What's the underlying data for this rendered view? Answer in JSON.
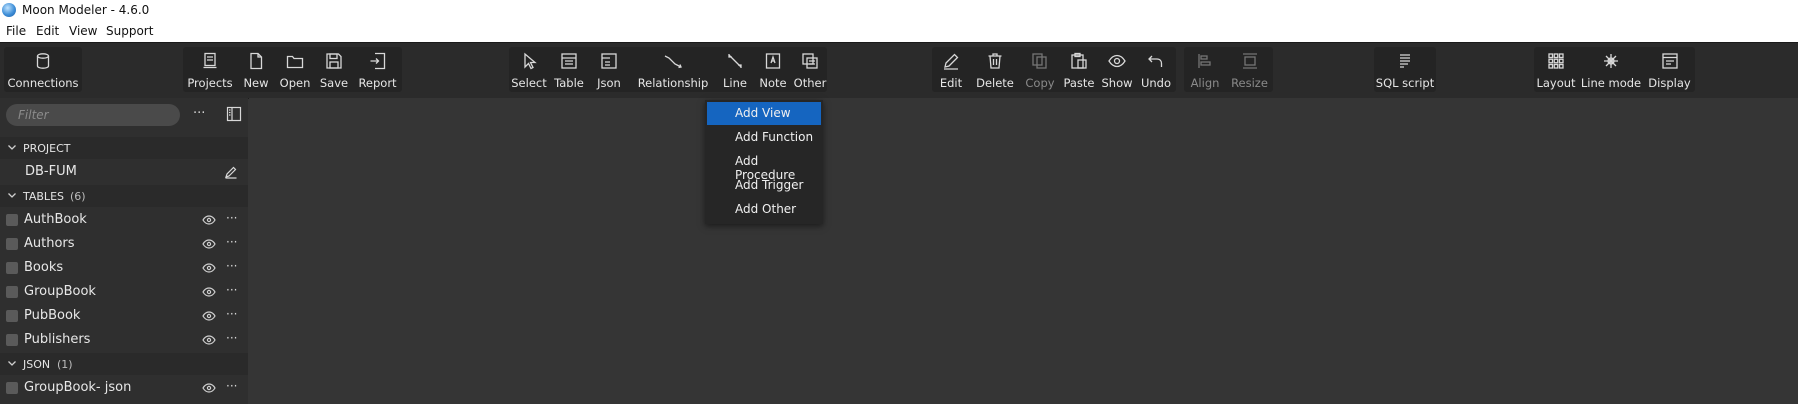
{
  "window": {
    "title": "Moon Modeler - 4.6.0"
  },
  "menu": [
    "File",
    "Edit",
    "View",
    "Support"
  ],
  "toolbar": {
    "connections": "Connections",
    "projects": "Projects",
    "new": "New",
    "open": "Open",
    "save": "Save",
    "report": "Report",
    "select": "Select",
    "table": "Table",
    "json": "Json",
    "relationship": "Relationship",
    "line": "Line",
    "note": "Note",
    "other": "Other",
    "edit": "Edit",
    "delete": "Delete",
    "copy": "Copy",
    "paste": "Paste",
    "show": "Show",
    "undo": "Undo",
    "align": "Align",
    "resize": "Resize",
    "sql_script": "SQL script",
    "layout": "Layout",
    "line_mode": "Line mode",
    "display": "Display"
  },
  "sidebar": {
    "filter_placeholder": "Filter",
    "project_header": "PROJECT",
    "project_name": "DB-FUM",
    "tables_header": "TABLES",
    "tables_count": "(6)",
    "tables": [
      "AuthBook",
      "Authors",
      "Books",
      "GroupBook",
      "PubBook",
      "Publishers"
    ],
    "json_header": "JSON",
    "json_count": "(1)",
    "json_items": [
      "GroupBook- json"
    ]
  },
  "other_menu": {
    "items": [
      "Add View",
      "Add Function",
      "Add Procedure",
      "Add Trigger",
      "Add Other"
    ],
    "selected": "Add View"
  },
  "colors": {
    "accent": "#1565c0",
    "toolbar_bg": "#2b2b2b",
    "canvas_bg": "#353535",
    "sidebar_bg": "#2f2f2f"
  }
}
